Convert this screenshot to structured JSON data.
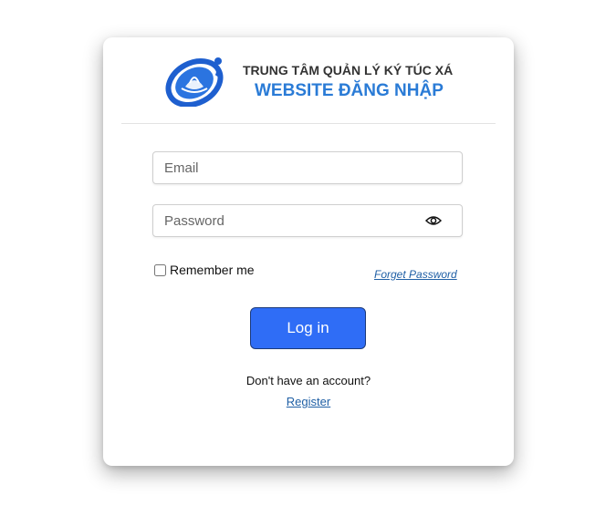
{
  "header": {
    "org_name": "TRUNG TÂM QUẢN LÝ KÝ TÚC XÁ",
    "site_title": "WEBSITE ĐĂNG NHẬP",
    "logo_icon": "dormitory-logo-icon"
  },
  "form": {
    "email_placeholder": "Email",
    "email_value": "",
    "password_placeholder": "Password",
    "password_value": "",
    "show_password_icon": "eye-icon",
    "remember_label": "Remember me",
    "remember_checked": false,
    "forget_label": "Forget Password",
    "login_label": "Log in"
  },
  "footer": {
    "no_account_text": "Don't have an account?",
    "register_label": "Register"
  },
  "colors": {
    "brand_blue": "#2a7bd6",
    "button_blue": "#2f6df6",
    "link_blue": "#1f5fa5"
  }
}
